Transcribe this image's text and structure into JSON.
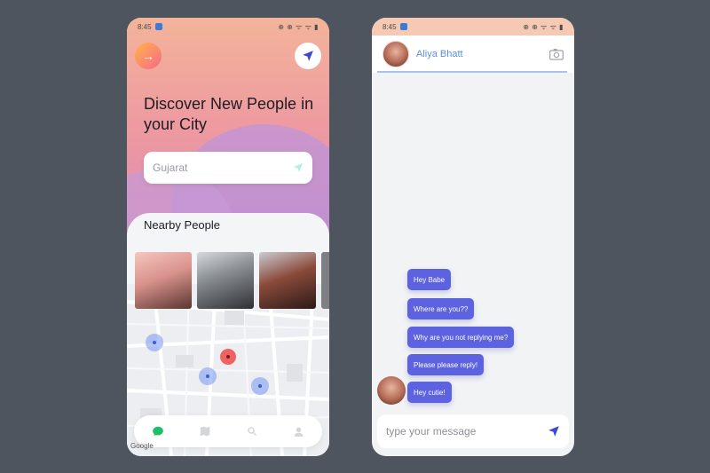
{
  "status_bar": {
    "time": "8:45",
    "icons": "⊕ ⊕ ᯤ ᯤ ▮"
  },
  "discover": {
    "headline": "Discover New People in your City",
    "city_input": {
      "value": "Gujarat",
      "placeholder": "Gujarat"
    },
    "nearby_title": "Nearby People",
    "people": [
      {
        "name": "person-1"
      },
      {
        "name": "person-2"
      },
      {
        "name": "person-3"
      }
    ],
    "map_pins": [
      {
        "color": "blue"
      },
      {
        "color": "red"
      },
      {
        "color": "blue"
      },
      {
        "color": "blue"
      }
    ],
    "map_attribution": "Google",
    "nav_items": [
      {
        "name": "chat-icon",
        "active": true
      },
      {
        "name": "map-icon",
        "active": false
      },
      {
        "name": "search-icon",
        "active": false
      },
      {
        "name": "profile-icon",
        "active": false
      }
    ]
  },
  "chat": {
    "contact_name": "Aliya Bhatt",
    "messages": [
      {
        "text": "Hey Babe"
      },
      {
        "text": "Where are you??"
      },
      {
        "text": "Why are you not replying me?"
      },
      {
        "text": "Please please reply!"
      },
      {
        "text": "Hey cutie!"
      }
    ],
    "composer_placeholder": "type your message"
  },
  "colors": {
    "accent": "#5c62e0",
    "name_blue": "#5b8ee6",
    "background": "#4e555e"
  }
}
